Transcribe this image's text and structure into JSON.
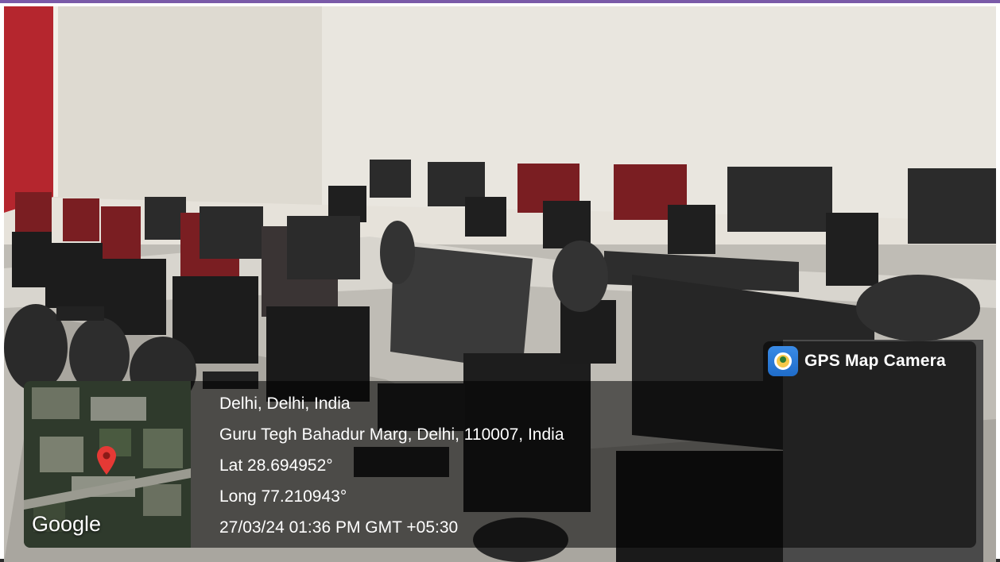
{
  "overlay": {
    "app_name": "GPS Map Camera",
    "app_icon": "gps-map-camera-icon",
    "map_logo": "Google",
    "lines": [
      "Delhi, Delhi, India",
      "Guru Tegh Bahadur Marg, Delhi, 110007, India",
      "Lat 28.694952°",
      "Long 77.210943°",
      "27/03/24 01:36 PM GMT +05:30"
    ]
  },
  "colors": {
    "accent_border": "#7a5aa8",
    "wall": "#e6e2da",
    "curtain": "#b5262e",
    "monitor": "#2b2b2b",
    "red_monitor": "#7a1e22",
    "pin": "#e53935"
  }
}
